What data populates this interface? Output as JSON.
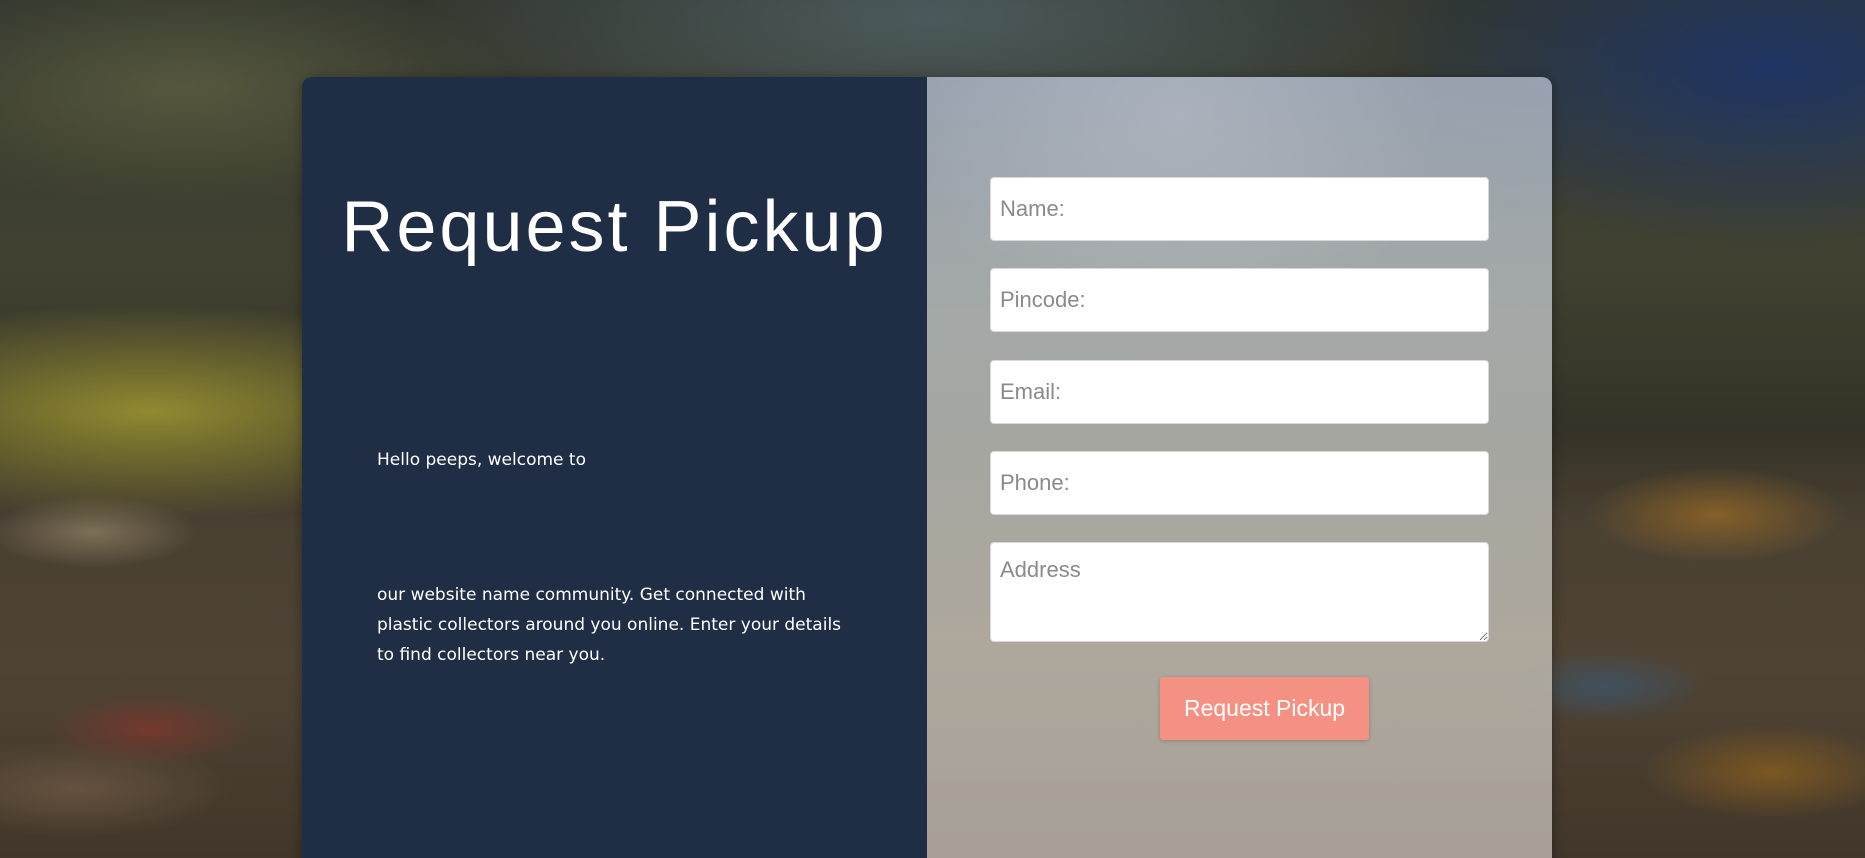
{
  "page": {
    "title": "Request Pickup",
    "welcome_line": "Hello peeps, welcome to",
    "description": "our website name community. Get connected with plastic collectors around you online. Enter your details to find collectors near you."
  },
  "form": {
    "name_placeholder": "Name:",
    "pincode_placeholder": "Pincode:",
    "email_placeholder": "Email:",
    "phone_placeholder": "Phone:",
    "address_placeholder": "Address",
    "submit_label": "Request Pickup"
  },
  "colors": {
    "left_panel": "#1f2d45",
    "button": "#f59183"
  }
}
